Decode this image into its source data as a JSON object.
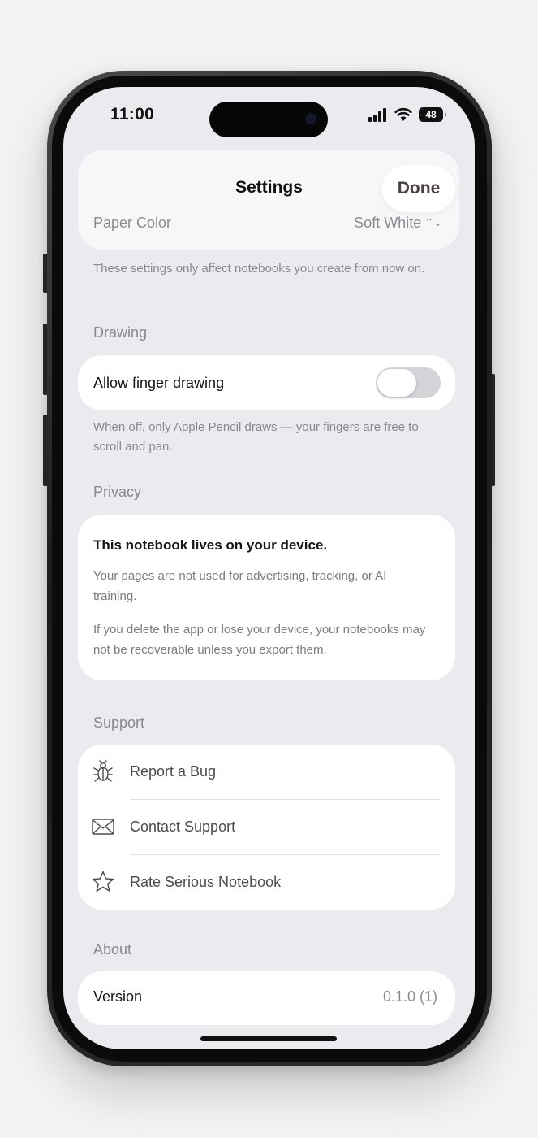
{
  "status_bar": {
    "time": "11:00",
    "battery": "48"
  },
  "header": {
    "title": "Settings",
    "done_label": "Done",
    "paper_color_label": "Paper Color",
    "paper_color_value": "Soft White"
  },
  "paper_note": "These settings only affect notebooks you create from now on.",
  "drawing": {
    "section_title": "Drawing",
    "finger_drawing_label": "Allow finger drawing",
    "finger_drawing_enabled": false,
    "note": "When off, only Apple Pencil draws — your fingers are free to scroll and pan."
  },
  "privacy": {
    "section_title": "Privacy",
    "headline": "This notebook lives on your device.",
    "paragraph_1": "Your pages are not used for advertising, tracking, or AI training.",
    "paragraph_2": "If you delete the app or lose your device, your notebooks may not be recoverable unless you export them."
  },
  "support": {
    "section_title": "Support",
    "items": [
      {
        "label": "Report a Bug",
        "icon": "bug-icon"
      },
      {
        "label": "Contact Support",
        "icon": "envelope-icon"
      },
      {
        "label": "Rate Serious Notebook",
        "icon": "star-icon"
      }
    ]
  },
  "about": {
    "section_title": "About",
    "version_label": "Version",
    "version_value": "0.1.0 (1)"
  },
  "colors": {
    "screen_background": "#eceaee",
    "card_background": "#ffffff",
    "secondary_text": "#8a888d",
    "toggle_off": "#d4d3d8"
  }
}
